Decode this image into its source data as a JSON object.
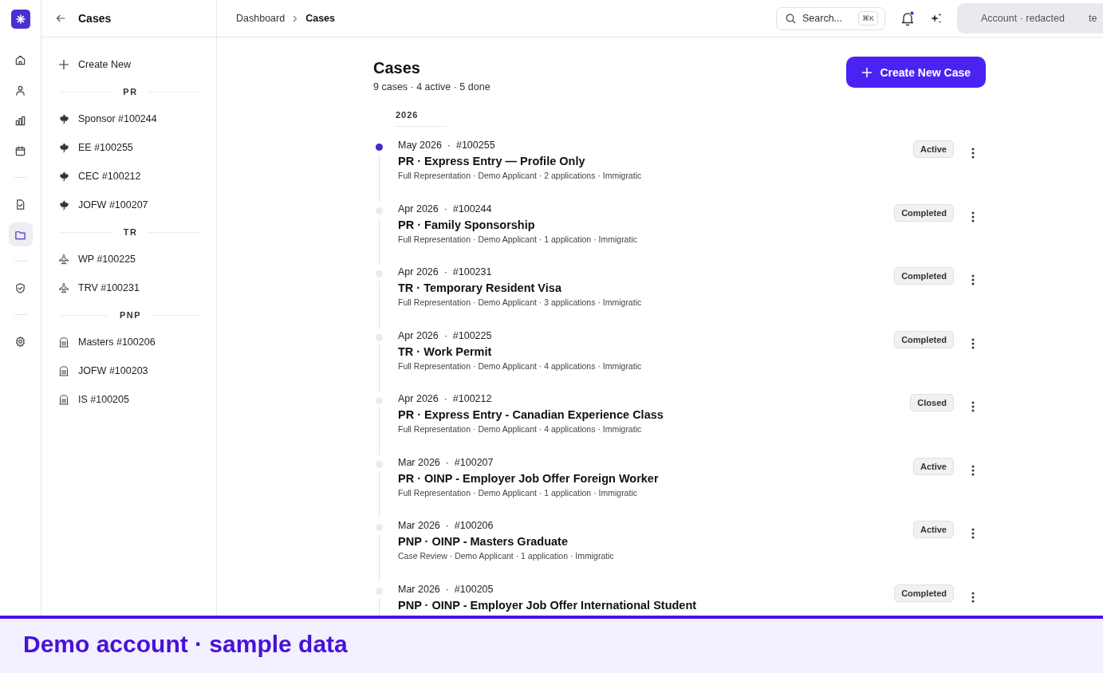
{
  "rail": {
    "groups": [
      [
        {
          "kind": "home",
          "selected": false
        },
        {
          "kind": "person",
          "selected": false
        },
        {
          "kind": "chart",
          "selected": false
        },
        {
          "kind": "calendar",
          "selected": false
        }
      ],
      [
        {
          "kind": "document",
          "selected": false
        },
        {
          "kind": "folder",
          "selected": true
        }
      ],
      [
        {
          "kind": "shield",
          "selected": false
        }
      ],
      [
        {
          "kind": "gear",
          "selected": false
        }
      ]
    ]
  },
  "sidebar": {
    "title": "Cases",
    "create_label": "Create New",
    "groups": [
      {
        "label": "PR",
        "kind": "leaf",
        "items": [
          "Sponsor #100244",
          "EE #100255",
          "CEC #100212",
          "JOFW #100207"
        ]
      },
      {
        "label": "TR",
        "kind": "plane",
        "items": [
          "WP #100225",
          "TRV #100231"
        ]
      },
      {
        "label": "PNP",
        "kind": "building",
        "items": [
          "Masters #100206",
          "JOFW #100203",
          "IS #100205"
        ]
      }
    ]
  },
  "header": {
    "breadcrumbs": [
      "Dashboard",
      "Cases"
    ],
    "search": {
      "placeholder": "Search...",
      "shortcut": "⌘K"
    },
    "notifications_unread": true,
    "account": "Account · redacted",
    "account_overflow": "te"
  },
  "page": {
    "title": "Cases",
    "summary": "9 cases · 4 active · 5 done",
    "create_button": "Create New Case",
    "year": "2026",
    "cases": [
      {
        "date": "May 2026  ·  #100255",
        "title": "PR · Express Entry — Profile Only",
        "meta": "Full Representation · Demo Applicant · 2 applications · Immigratic",
        "status": "Active",
        "highlighted": true
      },
      {
        "date": "Apr 2026  ·  #100244",
        "title": "PR · Family Sponsorship",
        "meta": "Full Representation · Demo Applicant · 1 application · Immigratic",
        "status": "Completed",
        "highlighted": false
      },
      {
        "date": "Apr 2026  ·  #100231",
        "title": "TR · Temporary Resident Visa",
        "meta": "Full Representation · Demo Applicant · 3 applications · Immigratic",
        "status": "Completed",
        "highlighted": false
      },
      {
        "date": "Apr 2026  ·  #100225",
        "title": "TR · Work Permit",
        "meta": "Full Representation · Demo Applicant · 4 applications · Immigratic",
        "status": "Completed",
        "highlighted": false
      },
      {
        "date": "Apr 2026  ·  #100212",
        "title": "PR · Express Entry - Canadian Experience Class",
        "meta": "Full Representation · Demo Applicant · 4 applications · Immigratic",
        "status": "Closed",
        "highlighted": false
      },
      {
        "date": "Mar 2026  ·  #100207",
        "title": "PR · OINP - Employer Job Offer Foreign Worker",
        "meta": "Full Representation · Demo Applicant · 1 application · Immigratic",
        "status": "Active",
        "highlighted": false
      },
      {
        "date": "Mar 2026  ·  #100206",
        "title": "PNP · OINP - Masters Graduate",
        "meta": "Case Review · Demo Applicant · 1 application · Immigratic",
        "status": "Active",
        "highlighted": false
      },
      {
        "date": "Mar 2026  ·  #100205",
        "title": "PNP · OINP - Employer Job Offer International Student",
        "status": "Completed",
        "highlighted": false
      }
    ]
  },
  "banner": {
    "text": "Demo account · sample data"
  }
}
